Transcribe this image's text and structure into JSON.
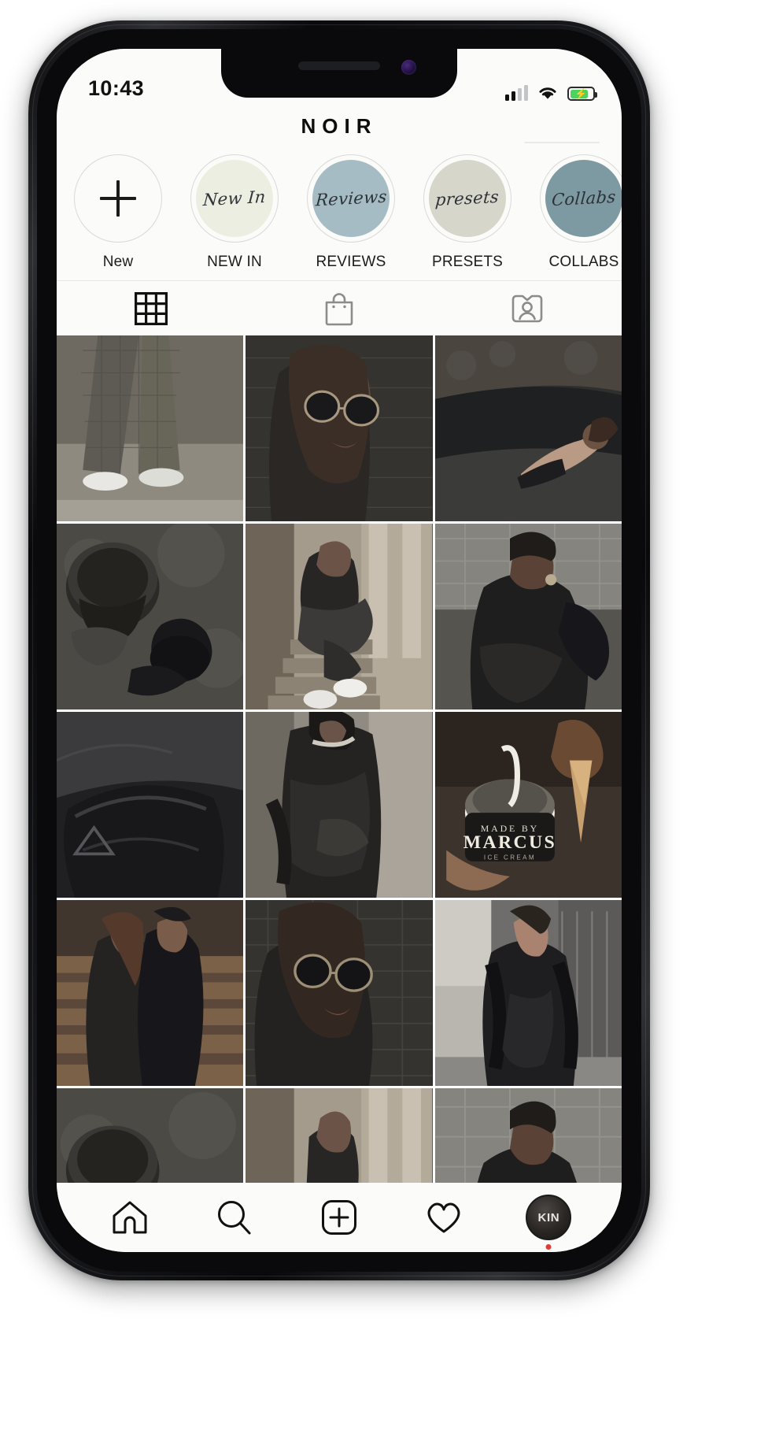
{
  "status_bar": {
    "time": "10:43",
    "signal_icon": "cellular-signal-icon",
    "wifi_icon": "wifi-icon",
    "battery_icon": "battery-charging-icon",
    "battery_level_percent": 82
  },
  "header": {
    "title": "NOIR"
  },
  "highlights": [
    {
      "label": "New",
      "script": "",
      "bg": "#fbfbfa",
      "type": "add"
    },
    {
      "label": "NEW IN",
      "script": "New In",
      "bg": "#eceee1",
      "type": "story"
    },
    {
      "label": "REVIEWS",
      "script": "Reviews",
      "bg": "#a5bcc5",
      "type": "story"
    },
    {
      "label": "PRESETS",
      "script": "presets",
      "bg": "#d6d6ca",
      "type": "story"
    },
    {
      "label": "COLLABS",
      "script": "Collabs",
      "bg": "#7d9aa2",
      "type": "story"
    }
  ],
  "profile_tabs": [
    {
      "name": "grid-tab",
      "icon": "grid-icon",
      "active": true
    },
    {
      "name": "shop-tab",
      "icon": "shopping-bag-icon",
      "active": false
    },
    {
      "name": "tagged-tab",
      "icon": "tagged-person-icon",
      "active": false
    }
  ],
  "grid_posts": [
    {
      "alt": "plaid-wide-trousers-white-sneakers",
      "tone": "#7d7a72"
    },
    {
      "alt": "woman-round-sunglasses-brick-wall",
      "tone": "#33312f"
    },
    {
      "alt": "woman-black-swimsuit-on-rocks",
      "tone": "#3b3b39"
    },
    {
      "alt": "coffee-cup-overhead-black-boots",
      "tone": "#44423d"
    },
    {
      "alt": "woman-sitting-on-stone-steps",
      "tone": "#5c5851"
    },
    {
      "alt": "man-black-puffer-jacket-seated",
      "tone": "#403e3b"
    },
    {
      "alt": "black-nylon-shoulder-bag-closeup",
      "tone": "#27272a"
    },
    {
      "alt": "person-black-blazer-chain-necklace",
      "tone": "#3a3835"
    },
    {
      "alt": "hand-holding-marcus-ice-cream-cup",
      "tone": "#5a4b3f"
    },
    {
      "alt": "couple-embracing-on-wooden-bench",
      "tone": "#4b3e33"
    },
    {
      "alt": "woman-sunglasses-leaning-brick-wall",
      "tone": "#35332f"
    },
    {
      "alt": "man-black-puffer-coat-street",
      "tone": "#4b4a49"
    },
    {
      "alt": "coffee-cup-overhead-partial",
      "tone": "#44423d"
    },
    {
      "alt": "woman-on-steps-partial",
      "tone": "#6a655d"
    },
    {
      "alt": "man-puffer-jacket-partial",
      "tone": "#3f3d3a"
    }
  ],
  "bottom_nav": [
    {
      "name": "home-nav-button",
      "icon": "home-icon"
    },
    {
      "name": "search-nav-button",
      "icon": "search-icon"
    },
    {
      "name": "create-nav-button",
      "icon": "plus-square-icon"
    },
    {
      "name": "activity-nav-button",
      "icon": "heart-icon"
    },
    {
      "name": "profile-nav-button",
      "icon": "avatar-icon",
      "avatar_text": "KIN"
    }
  ],
  "colors": {
    "screen_bg": "#fbfbfa",
    "text_primary": "#0d0d0d",
    "battery_green": "#4bd25f",
    "notification_red": "#e23a3a"
  }
}
